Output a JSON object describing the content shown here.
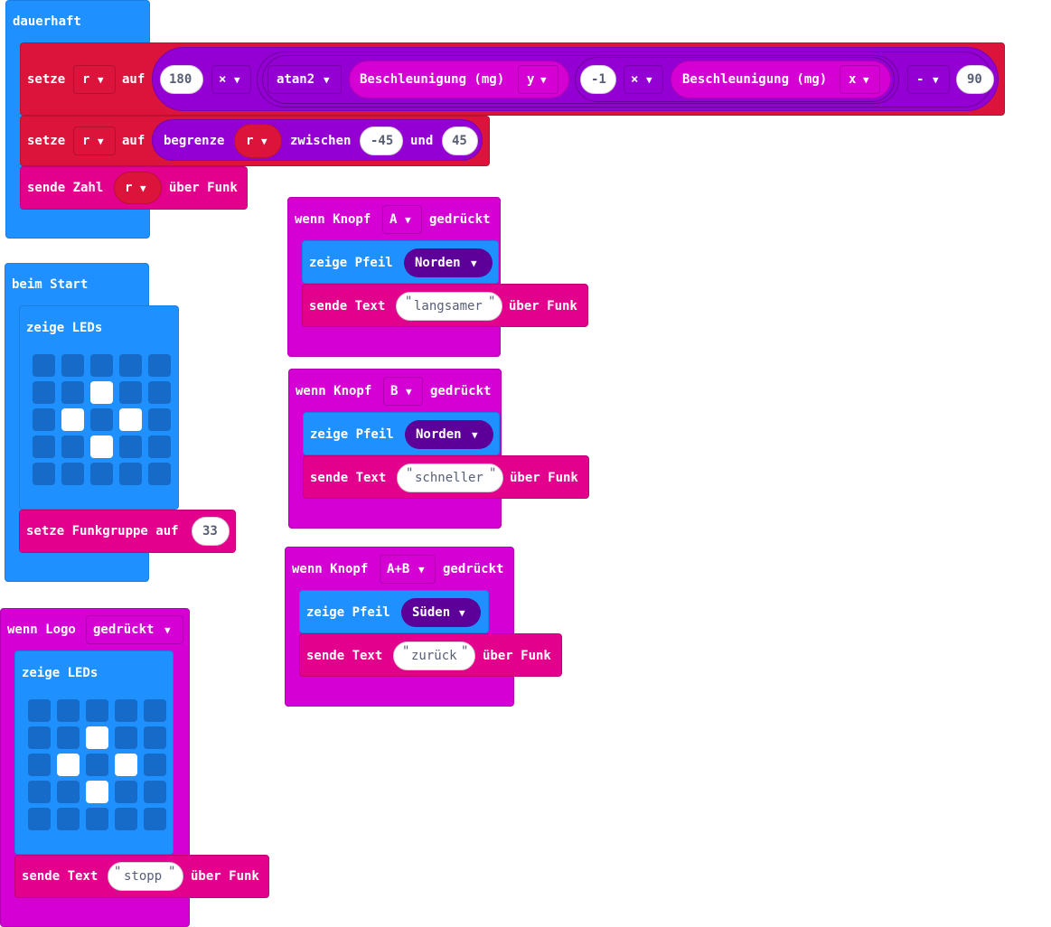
{
  "forever": {
    "hat_label": "dauerhaft",
    "set_label": "setze",
    "var_r": "r",
    "to_label": "auf",
    "n180": "180",
    "times": "×",
    "atan2": "atan2",
    "accel_label": "Beschleunigung (mg)",
    "axis_y": "y",
    "neg1": "-1",
    "axis_x": "x",
    "minus": "-",
    "n90": "90",
    "constrain_label": "begrenze",
    "between_label": "zwischen",
    "lo": "-45",
    "and_label": "und",
    "hi": "45",
    "send_number_label": "sende Zahl",
    "over_radio": "über Funk"
  },
  "on_start": {
    "hat_label": "beim Start",
    "show_leds_label": "zeige LEDs",
    "leds": [
      [
        0,
        0,
        0,
        0,
        0
      ],
      [
        0,
        0,
        1,
        0,
        0
      ],
      [
        0,
        1,
        0,
        1,
        0
      ],
      [
        0,
        0,
        1,
        0,
        0
      ],
      [
        0,
        0,
        0,
        0,
        0
      ]
    ],
    "set_group_label": "setze Funkgruppe auf",
    "group_value": "33"
  },
  "on_logo": {
    "when_logo_label": "wenn Logo",
    "event": "gedrückt",
    "show_leds_label": "zeige LEDs",
    "leds": [
      [
        0,
        0,
        0,
        0,
        0
      ],
      [
        0,
        0,
        1,
        0,
        0
      ],
      [
        0,
        1,
        0,
        1,
        0
      ],
      [
        0,
        0,
        1,
        0,
        0
      ],
      [
        0,
        0,
        0,
        0,
        0
      ]
    ],
    "send_text_label": "sende Text",
    "text_value": "stopp",
    "over_radio": "über Funk"
  },
  "button_handlers": [
    {
      "when_label": "wenn Knopf",
      "button": "A",
      "pressed": "gedrückt",
      "show_arrow_label": "zeige Pfeil",
      "direction": "Norden",
      "send_text_label": "sende Text",
      "text_value": "langsamer",
      "over_radio": "über Funk"
    },
    {
      "when_label": "wenn Knopf",
      "button": "B",
      "pressed": "gedrückt",
      "show_arrow_label": "zeige Pfeil",
      "direction": "Norden",
      "send_text_label": "sende Text",
      "text_value": "schneller",
      "over_radio": "über Funk"
    },
    {
      "when_label": "wenn Knopf",
      "button": "A+B",
      "pressed": "gedrückt",
      "show_arrow_label": "zeige Pfeil",
      "direction": "Süden",
      "send_text_label": "sende Text",
      "text_value": "zurück",
      "over_radio": "über Funk"
    }
  ],
  "quote": "\"",
  "caret": "▼",
  "colors": {
    "basic": "#1e90ff",
    "variables": "#dc143c",
    "radio": "#e3008c",
    "input": "#d400d4",
    "math": "#9400d3",
    "direction_pill": "#5c0099"
  }
}
